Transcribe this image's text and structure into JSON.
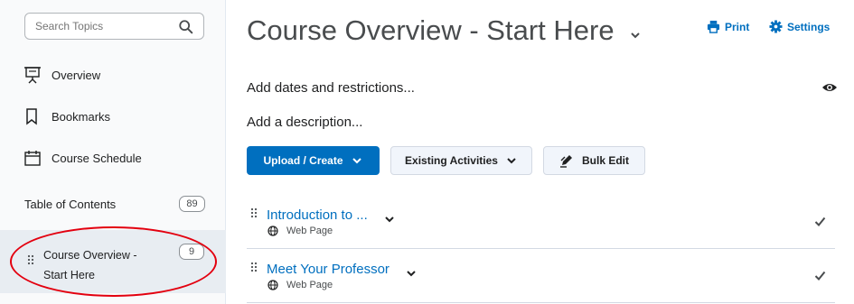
{
  "sidebar": {
    "search": {
      "placeholder": "Search Topics",
      "icon": "search-icon"
    },
    "items": [
      {
        "label": "Overview",
        "icon": "presentation-board-icon"
      },
      {
        "label": "Bookmarks",
        "icon": "bookmark-icon"
      },
      {
        "label": "Course Schedule",
        "icon": "calendar-icon"
      }
    ],
    "toc": {
      "label": "Table of Contents",
      "count": "89"
    },
    "module": {
      "label_line1": "Course Overview -",
      "label_line2": "Start Here",
      "count": "9"
    }
  },
  "main": {
    "title": "Course Overview - Start Here",
    "print_label": "Print",
    "settings_label": "Settings",
    "dates_text": "Add dates and restrictions...",
    "description_text": "Add a description...",
    "buttons": {
      "upload": "Upload / Create",
      "existing": "Existing Activities",
      "bulk": "Bulk Edit"
    },
    "topics": [
      {
        "title": "Introduction to ...",
        "type": "Web Page"
      },
      {
        "title": "Meet Your Professor",
        "type": "Web Page"
      }
    ]
  },
  "colors": {
    "accent": "#006fbf",
    "highlight_circle": "#e3000f"
  }
}
